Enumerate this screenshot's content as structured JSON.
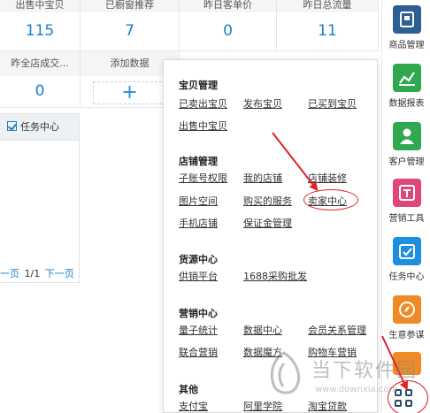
{
  "stats": {
    "row1": [
      {
        "label": "出售中宝贝",
        "value": "115"
      },
      {
        "label": "已橱窗推荐",
        "value": "7"
      },
      {
        "label": "昨日客单价",
        "value": "0"
      },
      {
        "label": "昨日总流量",
        "value": "11"
      }
    ],
    "row2": [
      {
        "label": "昨全店成交...",
        "value": "0"
      },
      {
        "label": "添加数据",
        "value": "+"
      }
    ]
  },
  "task_panel": {
    "title": "任务中心",
    "pager": {
      "prev": "一页",
      "current": "1/1",
      "next": "下一页"
    }
  },
  "menu": {
    "groups": [
      {
        "title": "宝贝管理",
        "items": [
          "已卖出宝贝",
          "发布宝贝",
          "已买到宝贝",
          "出售中宝贝"
        ]
      },
      {
        "title": "店铺管理",
        "items": [
          "子账号权限",
          "我的店铺",
          "店铺装修",
          "图片空间",
          "购买的服务",
          "卖家中心",
          "手机店铺",
          "保证金管理"
        ]
      },
      {
        "title": "货源中心",
        "items": [
          "供销平台",
          "1688采购批发"
        ]
      },
      {
        "title": "营销中心",
        "items": [
          "量子统计",
          "数据中心",
          "会员关系管理",
          "联合营销",
          "数据魔方",
          "购物车营销"
        ]
      },
      {
        "title": "其他",
        "items": [
          "支付宝",
          "阿里学院",
          "淘宝贷款"
        ]
      }
    ]
  },
  "sidebar": {
    "items": [
      {
        "label": "商品管理",
        "icon": "product-icon",
        "color": "#2d5f93"
      },
      {
        "label": "数据报表",
        "icon": "chart-icon",
        "color": "#2fa84f"
      },
      {
        "label": "客户管理",
        "icon": "customer-icon",
        "color": "#2fa84f"
      },
      {
        "label": "营销工具",
        "icon": "discount-icon",
        "color": "#e0457b"
      },
      {
        "label": "任务中心",
        "icon": "task-icon",
        "color": "#1d8fe0"
      },
      {
        "label": "生意参谋",
        "icon": "compass-icon",
        "color": "#f08a24"
      },
      {
        "label": "",
        "icon": "partial-icon",
        "color": "#f08a24"
      }
    ]
  },
  "watermark": {
    "title": "当下软件园",
    "url": "www.downxia.com"
  }
}
